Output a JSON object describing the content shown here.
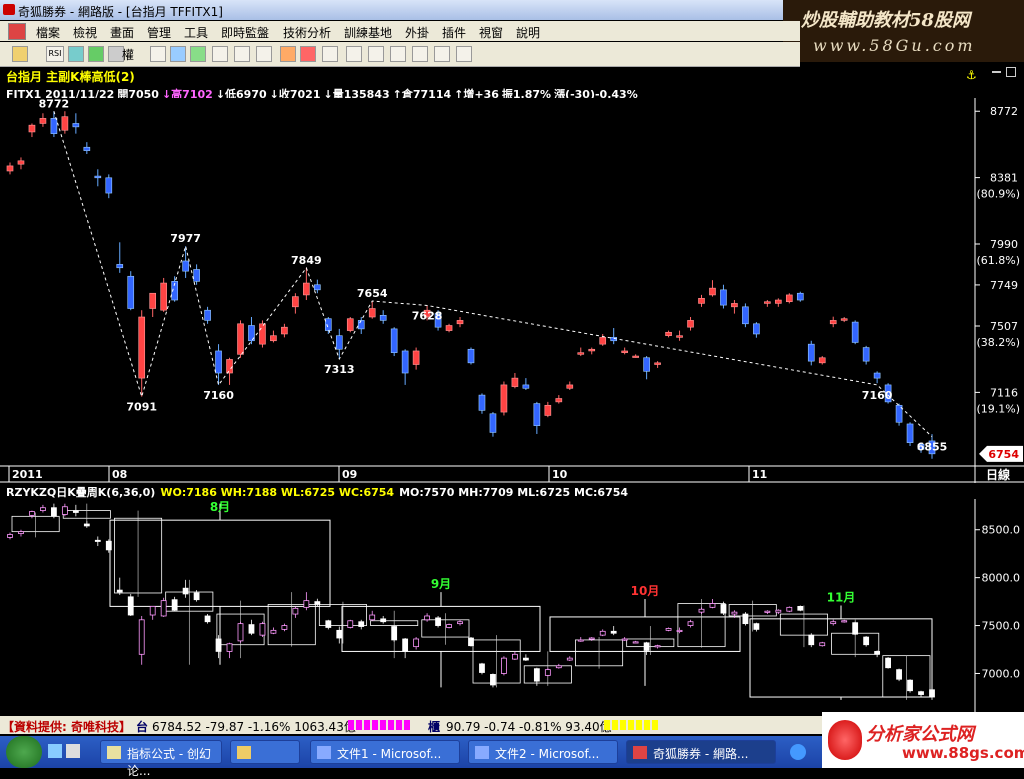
{
  "window": {
    "title": "奇狐勝券 - 網路版 - [台指月 TFFITX1]"
  },
  "banner": {
    "line1": "炒股輔助教材58股网",
    "line2": "www.58Gu.com"
  },
  "menu": [
    "檔案",
    "檢視",
    "畫面",
    "管理",
    "工具",
    "即時監盤",
    "技術分析",
    "訓練基地",
    "外掛",
    "插件",
    "視窗",
    "說明"
  ],
  "toolbar": {
    "items": [
      "RSI",
      "權"
    ]
  },
  "upper": {
    "title": "台指月 主副K棒高低(2)",
    "info": [
      {
        "t": "FITX1 2011/11/22",
        "c": "#ffffff"
      },
      {
        "t": "開7050",
        "c": "#ffffff"
      },
      {
        "t": "↓高7102",
        "c": "#ff66ff"
      },
      {
        "t": "↓低6970",
        "c": "#ffffff"
      },
      {
        "t": "↓收7021",
        "c": "#ffffff"
      },
      {
        "t": "↓量135843",
        "c": "#ffffff"
      },
      {
        "t": "↑倉77114",
        "c": "#ffffff"
      },
      {
        "t": "↑增+36",
        "c": "#ffffff"
      },
      {
        "t": "振1.87%",
        "c": "#ffffff"
      },
      {
        "t": "漲(-30)-0.43%",
        "c": "#ffffff"
      }
    ],
    "price_axis": [
      {
        "v": 8772,
        "label": "8772",
        "sub": ""
      },
      {
        "v": 8381,
        "label": "8381",
        "sub": "(80.9%)"
      },
      {
        "v": 7990,
        "label": "7990",
        "sub": "(61.8%)"
      },
      {
        "v": 7749,
        "label": "7749",
        "sub": ""
      },
      {
        "v": 7507,
        "label": "7507",
        "sub": "(38.2%)"
      },
      {
        "v": 7116,
        "label": "7116",
        "sub": "(19.1%)"
      }
    ],
    "last_price": "6754",
    "date_axis": [
      "2011",
      "08",
      "09",
      "10",
      "11"
    ],
    "date_unit": "日線"
  },
  "lower": {
    "header": [
      {
        "t": "RZYKZQ日K疊周K(6,36,0)",
        "c": "#ffffff"
      },
      {
        "t": "WO:7186 WH:7188 WL:6725 WC:6754",
        "c": "#ffff00"
      },
      {
        "t": "MO:7570 MH:7709 ML:6725 MC:6754",
        "c": "#ffffff"
      }
    ],
    "price_axis": [
      "8500.0",
      "8000.0",
      "7500.0",
      "7000.0"
    ],
    "month_labels": [
      {
        "t": "8月",
        "c": "#33ff33"
      },
      {
        "t": "9月",
        "c": "#33ff33"
      },
      {
        "t": "10月",
        "c": "#ff3333"
      },
      {
        "t": "11月",
        "c": "#33ff33"
      }
    ]
  },
  "chart_data": {
    "type": "candlestick",
    "title": "台指月 主副K棒高低(2)",
    "period": "daily",
    "ylim": [
      6700,
      8850
    ],
    "swing_points": [
      8772,
      7091,
      7977,
      7160,
      7849,
      7313,
      7654,
      7628,
      7160,
      6855,
      7230,
      6871,
      7495,
      7193,
      7777,
      7438,
      7709,
      7275,
      7562
    ],
    "candles": [
      {
        "o": 8420,
        "h": 8470,
        "l": 8400,
        "c": 8450
      },
      {
        "o": 8460,
        "h": 8500,
        "l": 8430,
        "c": 8480
      },
      {
        "o": 8650,
        "h": 8700,
        "l": 8620,
        "c": 8690
      },
      {
        "o": 8700,
        "h": 8760,
        "l": 8680,
        "c": 8730
      },
      {
        "o": 8730,
        "h": 8772,
        "l": 8620,
        "c": 8640
      },
      {
        "o": 8660,
        "h": 8772,
        "l": 8640,
        "c": 8740
      },
      {
        "o": 8700,
        "h": 8760,
        "l": 8640,
        "c": 8680
      },
      {
        "o": 8560,
        "h": 8590,
        "l": 8520,
        "c": 8540
      },
      {
        "o": 8390,
        "h": 8430,
        "l": 8330,
        "c": 8380
      },
      {
        "o": 8380,
        "h": 8400,
        "l": 8260,
        "c": 8290
      },
      {
        "o": 7870,
        "h": 8000,
        "l": 7820,
        "c": 7850
      },
      {
        "o": 7800,
        "h": 7830,
        "l": 7600,
        "c": 7610
      },
      {
        "o": 7200,
        "h": 7600,
        "l": 7091,
        "c": 7560
      },
      {
        "o": 7610,
        "h": 7700,
        "l": 7560,
        "c": 7700
      },
      {
        "o": 7600,
        "h": 7790,
        "l": 7590,
        "c": 7760
      },
      {
        "o": 7770,
        "h": 7800,
        "l": 7650,
        "c": 7660
      },
      {
        "o": 7890,
        "h": 7977,
        "l": 7790,
        "c": 7830
      },
      {
        "o": 7840,
        "h": 7870,
        "l": 7750,
        "c": 7770
      },
      {
        "o": 7600,
        "h": 7620,
        "l": 7520,
        "c": 7540
      },
      {
        "o": 7360,
        "h": 7400,
        "l": 7160,
        "c": 7230
      },
      {
        "o": 7230,
        "h": 7320,
        "l": 7160,
        "c": 7310
      },
      {
        "o": 7340,
        "h": 7540,
        "l": 7320,
        "c": 7520
      },
      {
        "o": 7510,
        "h": 7560,
        "l": 7400,
        "c": 7420
      },
      {
        "o": 7400,
        "h": 7540,
        "l": 7380,
        "c": 7520
      },
      {
        "o": 7420,
        "h": 7480,
        "l": 7410,
        "c": 7450
      },
      {
        "o": 7460,
        "h": 7520,
        "l": 7440,
        "c": 7500
      },
      {
        "o": 7620,
        "h": 7700,
        "l": 7580,
        "c": 7680
      },
      {
        "o": 7690,
        "h": 7849,
        "l": 7660,
        "c": 7760
      },
      {
        "o": 7750,
        "h": 7780,
        "l": 7700,
        "c": 7720
      },
      {
        "o": 7550,
        "h": 7560,
        "l": 7460,
        "c": 7480
      },
      {
        "o": 7450,
        "h": 7490,
        "l": 7313,
        "c": 7370
      },
      {
        "o": 7480,
        "h": 7560,
        "l": 7470,
        "c": 7550
      },
      {
        "o": 7540,
        "h": 7560,
        "l": 7460,
        "c": 7490
      },
      {
        "o": 7560,
        "h": 7654,
        "l": 7550,
        "c": 7610
      },
      {
        "o": 7570,
        "h": 7600,
        "l": 7520,
        "c": 7540
      },
      {
        "o": 7490,
        "h": 7500,
        "l": 7330,
        "c": 7350
      },
      {
        "o": 7360,
        "h": 7370,
        "l": 7160,
        "c": 7230
      },
      {
        "o": 7280,
        "h": 7380,
        "l": 7250,
        "c": 7360
      },
      {
        "o": 7560,
        "h": 7628,
        "l": 7540,
        "c": 7600
      },
      {
        "o": 7580,
        "h": 7600,
        "l": 7480,
        "c": 7500
      },
      {
        "o": 7480,
        "h": 7520,
        "l": 7470,
        "c": 7510
      },
      {
        "o": 7520,
        "h": 7560,
        "l": 7500,
        "c": 7540
      },
      {
        "o": 7370,
        "h": 7380,
        "l": 7280,
        "c": 7290
      },
      {
        "o": 7100,
        "h": 7110,
        "l": 6990,
        "c": 7010
      },
      {
        "o": 6990,
        "h": 7000,
        "l": 6855,
        "c": 6880
      },
      {
        "o": 7000,
        "h": 7180,
        "l": 6980,
        "c": 7160
      },
      {
        "o": 7150,
        "h": 7230,
        "l": 7140,
        "c": 7200
      },
      {
        "o": 7160,
        "h": 7200,
        "l": 7130,
        "c": 7140
      },
      {
        "o": 7050,
        "h": 7060,
        "l": 6871,
        "c": 6920
      },
      {
        "o": 6980,
        "h": 7060,
        "l": 6970,
        "c": 7040
      },
      {
        "o": 7060,
        "h": 7100,
        "l": 7050,
        "c": 7080
      },
      {
        "o": 7140,
        "h": 7180,
        "l": 7130,
        "c": 7160
      },
      {
        "o": 7340,
        "h": 7380,
        "l": 7330,
        "c": 7350
      },
      {
        "o": 7360,
        "h": 7380,
        "l": 7340,
        "c": 7370
      },
      {
        "o": 7400,
        "h": 7460,
        "l": 7390,
        "c": 7440
      },
      {
        "o": 7440,
        "h": 7495,
        "l": 7400,
        "c": 7420
      },
      {
        "o": 7350,
        "h": 7380,
        "l": 7340,
        "c": 7360
      },
      {
        "o": 7330,
        "h": 7340,
        "l": 7320,
        "c": 7330
      },
      {
        "o": 7320,
        "h": 7330,
        "l": 7193,
        "c": 7240
      },
      {
        "o": 7280,
        "h": 7300,
        "l": 7260,
        "c": 7290
      },
      {
        "o": 7450,
        "h": 7480,
        "l": 7440,
        "c": 7470
      },
      {
        "o": 7440,
        "h": 7480,
        "l": 7420,
        "c": 7450
      },
      {
        "o": 7500,
        "h": 7560,
        "l": 7480,
        "c": 7540
      },
      {
        "o": 7640,
        "h": 7690,
        "l": 7620,
        "c": 7670
      },
      {
        "o": 7690,
        "h": 7777,
        "l": 7680,
        "c": 7730
      },
      {
        "o": 7720,
        "h": 7750,
        "l": 7610,
        "c": 7630
      },
      {
        "o": 7620,
        "h": 7660,
        "l": 7580,
        "c": 7640
      },
      {
        "o": 7620,
        "h": 7640,
        "l": 7500,
        "c": 7520
      },
      {
        "o": 7520,
        "h": 7530,
        "l": 7438,
        "c": 7460
      },
      {
        "o": 7640,
        "h": 7660,
        "l": 7620,
        "c": 7650
      },
      {
        "o": 7640,
        "h": 7670,
        "l": 7620,
        "c": 7660
      },
      {
        "o": 7650,
        "h": 7700,
        "l": 7640,
        "c": 7690
      },
      {
        "o": 7700,
        "h": 7709,
        "l": 7650,
        "c": 7660
      },
      {
        "o": 7400,
        "h": 7420,
        "l": 7275,
        "c": 7300
      },
      {
        "o": 7290,
        "h": 7330,
        "l": 7280,
        "c": 7320
      },
      {
        "o": 7520,
        "h": 7562,
        "l": 7500,
        "c": 7540
      },
      {
        "o": 7540,
        "h": 7560,
        "l": 7530,
        "c": 7550
      },
      {
        "o": 7530,
        "h": 7540,
        "l": 7400,
        "c": 7410
      },
      {
        "o": 7380,
        "h": 7390,
        "l": 7280,
        "c": 7300
      },
      {
        "o": 7230,
        "h": 7240,
        "l": 7170,
        "c": 7200
      },
      {
        "o": 7160,
        "h": 7170,
        "l": 7050,
        "c": 7060
      },
      {
        "o": 7040,
        "h": 7050,
        "l": 6920,
        "c": 6940
      },
      {
        "o": 6930,
        "h": 6940,
        "l": 6800,
        "c": 6820
      },
      {
        "o": 6810,
        "h": 6820,
        "l": 6760,
        "c": 6780
      },
      {
        "o": 6830,
        "h": 6870,
        "l": 6725,
        "c": 6754
      }
    ]
  },
  "weekly_chart": {
    "type": "candlestick",
    "ylim": [
      6650,
      8800
    ],
    "months": [
      {
        "label": "8月",
        "o": 8600,
        "h": 8772,
        "l": 7091,
        "c": 7700
      },
      {
        "label": "9月",
        "o": 7700,
        "h": 7849,
        "l": 6855,
        "c": 7230
      },
      {
        "label": "10月",
        "o": 7230,
        "h": 7777,
        "l": 6871,
        "c": 7590
      },
      {
        "label": "11月",
        "o": 7570,
        "h": 7709,
        "l": 6725,
        "c": 6754
      }
    ],
    "weeks": [
      {
        "o": 8480,
        "h": 8680,
        "l": 8420,
        "c": 8640
      },
      {
        "o": 8620,
        "h": 8772,
        "l": 8560,
        "c": 8700
      },
      {
        "o": 8620,
        "h": 8700,
        "l": 7800,
        "c": 7840
      },
      {
        "o": 7850,
        "h": 7977,
        "l": 7091,
        "c": 7650
      },
      {
        "o": 7620,
        "h": 7760,
        "l": 7160,
        "c": 7300
      },
      {
        "o": 7300,
        "h": 7849,
        "l": 7280,
        "c": 7720
      },
      {
        "o": 7720,
        "h": 7749,
        "l": 7313,
        "c": 7500
      },
      {
        "o": 7500,
        "h": 7654,
        "l": 7160,
        "c": 7550
      },
      {
        "o": 7560,
        "h": 7628,
        "l": 7300,
        "c": 7380
      },
      {
        "o": 7350,
        "h": 7400,
        "l": 6855,
        "c": 6900
      },
      {
        "o": 6900,
        "h": 7230,
        "l": 6871,
        "c": 7080
      },
      {
        "o": 7080,
        "h": 7380,
        "l": 7050,
        "c": 7350
      },
      {
        "o": 7360,
        "h": 7495,
        "l": 7193,
        "c": 7280
      },
      {
        "o": 7280,
        "h": 7777,
        "l": 7270,
        "c": 7730
      },
      {
        "o": 7720,
        "h": 7760,
        "l": 7438,
        "c": 7600
      },
      {
        "o": 7620,
        "h": 7709,
        "l": 7275,
        "c": 7400
      },
      {
        "o": 7420,
        "h": 7562,
        "l": 7170,
        "c": 7200
      },
      {
        "o": 7186,
        "h": 7188,
        "l": 6725,
        "c": 6754
      }
    ]
  },
  "statusbar": {
    "provider": "【資料提供: 奇唯科技】",
    "tw_label": "台",
    "tw_value": "6784.52 -79.87 -1.16% 1063.43億",
    "otc_label": "櫃",
    "otc_value": "90.79 -0.74 -0.81% 93.40億"
  },
  "taskbar": {
    "tasks": [
      "指标公式 - 创幻论...",
      "",
      "文件1 - Microsof...",
      "文件2 - Microsof...",
      "奇狐勝券 - 網路..."
    ]
  },
  "logo": {
    "line1": "分析家公式网",
    "line2": "www.88gs.com"
  }
}
